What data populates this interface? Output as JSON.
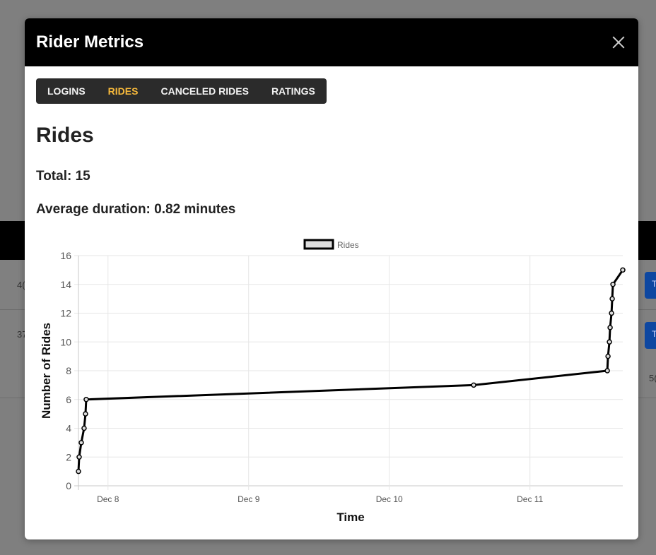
{
  "background": {
    "row1_text": "4(",
    "row2_text": "37",
    "row3_text": "5(",
    "button_glyph": "T"
  },
  "modal": {
    "title": "Rider Metrics",
    "tabs": [
      {
        "label": "LOGINS",
        "active": false
      },
      {
        "label": "RIDES",
        "active": true
      },
      {
        "label": "CANCELED RIDES",
        "active": false
      },
      {
        "label": "RATINGS",
        "active": false
      }
    ],
    "section_title": "Rides",
    "total_text": "Total: 15",
    "average_text": "Average duration: 0.82 minutes"
  },
  "chart_data": {
    "type": "line",
    "title": "",
    "xlabel": "Time",
    "ylabel": "Number of Rides",
    "ylim": [
      0,
      16
    ],
    "yticks": [
      0,
      2,
      4,
      6,
      8,
      10,
      12,
      14,
      16
    ],
    "xticks": [
      "Dec 8",
      "Dec 9",
      "Dec 10",
      "Dec 11"
    ],
    "grid": true,
    "legend_position": "top",
    "series": [
      {
        "name": "Rides",
        "color": "#000000",
        "fill": "#dddddd",
        "x": [
          7.79,
          7.795,
          7.81,
          7.83,
          7.84,
          7.845,
          10.6,
          11.55,
          11.555,
          11.565,
          11.57,
          11.58,
          11.585,
          11.59,
          11.66
        ],
        "y": [
          1,
          2,
          3,
          4,
          5,
          6,
          7,
          8,
          9,
          10,
          11,
          12,
          13,
          14,
          15
        ]
      }
    ]
  }
}
